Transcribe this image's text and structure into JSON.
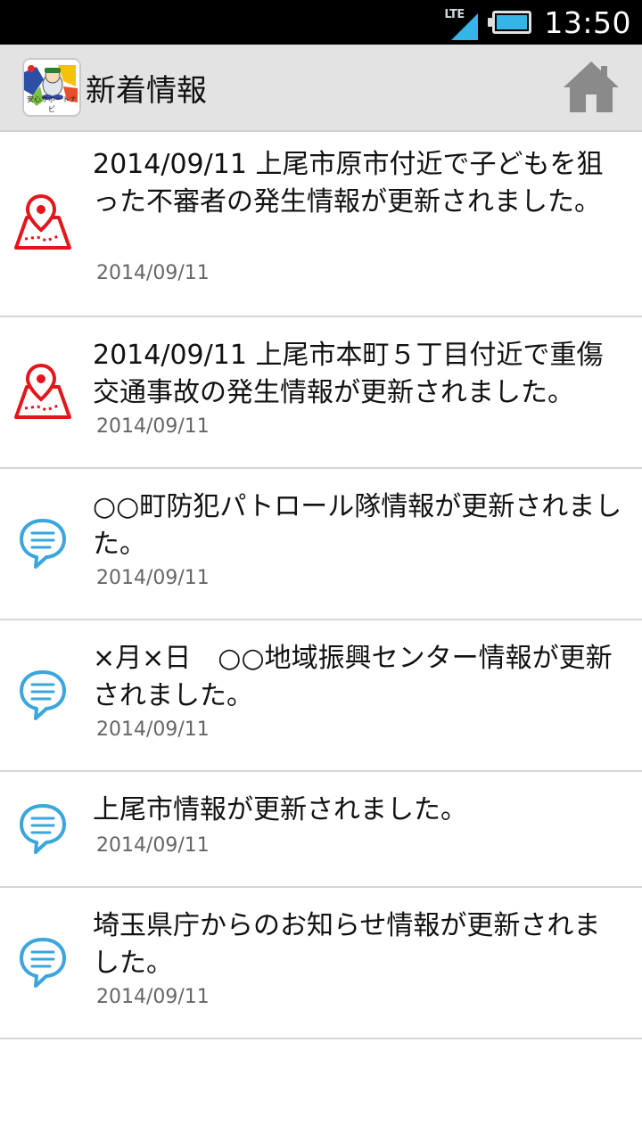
{
  "status_bar": {
    "network": "LTE",
    "time": "13:50"
  },
  "app_bar": {
    "app_icon_label": "安心サポートナビ",
    "title": "新着情報",
    "home_icon": "home-icon"
  },
  "news_items": [
    {
      "type": "map",
      "icon": "map-pin-icon",
      "text": "2014/09/11 上尾市原市付近で子どもを狙った不審者の発生情報が更新されました。",
      "date": "2014/09/11"
    },
    {
      "type": "map",
      "icon": "map-pin-icon",
      "text": "2014/09/11 上尾市本町５丁目付近で重傷交通事故の発生情報が更新されました。",
      "date": "2014/09/11"
    },
    {
      "type": "message",
      "icon": "chat-bubble-icon",
      "text": "○○町防犯パトロール隊情報が更新されました。",
      "date": "2014/09/11"
    },
    {
      "type": "message",
      "icon": "chat-bubble-icon",
      "text": "×月×日　○○地域振興センター情報が更新されました。",
      "date": "2014/09/11"
    },
    {
      "type": "message",
      "icon": "chat-bubble-icon",
      "text": "上尾市情報が更新されました。",
      "date": "2014/09/11"
    },
    {
      "type": "message",
      "icon": "chat-bubble-icon",
      "text": "埼玉県庁からのお知らせ情報が更新されました。",
      "date": "2014/09/11"
    }
  ],
  "colors": {
    "map_icon": "#e3161b",
    "message_icon": "#3aa6dd",
    "app_bar_bg": "#e3e3e3",
    "divider": "#d6d6d6"
  }
}
